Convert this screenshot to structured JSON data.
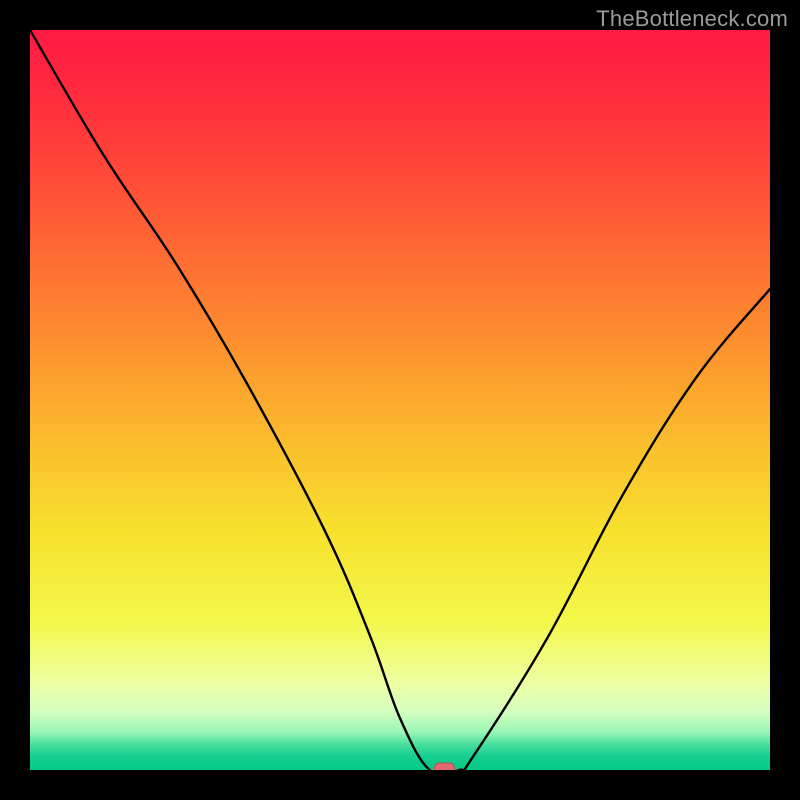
{
  "watermark": "TheBottleneck.com",
  "chart_data": {
    "type": "line",
    "title": "",
    "xlabel": "",
    "ylabel": "",
    "xlim": [
      0,
      100
    ],
    "ylim": [
      0,
      100
    ],
    "grid": false,
    "legend": false,
    "series": [
      {
        "name": "curve",
        "x": [
          0,
          10,
          20,
          30,
          40,
          46,
          50,
          54,
          58,
          60,
          70,
          80,
          90,
          100
        ],
        "y": [
          100,
          83,
          68,
          51,
          32,
          18,
          7,
          0,
          0,
          2,
          18,
          37,
          53,
          65
        ]
      }
    ],
    "minimum_marker": {
      "x": 56,
      "y": 0
    },
    "notes": "Smooth red→yellow→green vertical gradient; concentrated green band near bottom; V-shaped black curve; small red rounded-rect marker at minimum."
  },
  "colors": {
    "black": "#000000",
    "curve": "#000000",
    "marker_fill": "#e06a6f",
    "marker_stroke": "#b24d52",
    "gradient_stops": [
      {
        "offset": 0.0,
        "color": "#ff1a44"
      },
      {
        "offset": 0.08,
        "color": "#ff2a3e"
      },
      {
        "offset": 0.18,
        "color": "#ff4538"
      },
      {
        "offset": 0.3,
        "color": "#fe6a33"
      },
      {
        "offset": 0.42,
        "color": "#fd8f2f"
      },
      {
        "offset": 0.55,
        "color": "#fbbb2d"
      },
      {
        "offset": 0.68,
        "color": "#f7e22e"
      },
      {
        "offset": 0.8,
        "color": "#f3f84b"
      },
      {
        "offset": 0.88,
        "color": "#eeffa0"
      },
      {
        "offset": 0.92,
        "color": "#d6ffc0"
      },
      {
        "offset": 0.948,
        "color": "#9cf7b6"
      },
      {
        "offset": 0.965,
        "color": "#4be0a0"
      },
      {
        "offset": 0.98,
        "color": "#18cf90"
      },
      {
        "offset": 1.0,
        "color": "#03c987"
      }
    ]
  }
}
